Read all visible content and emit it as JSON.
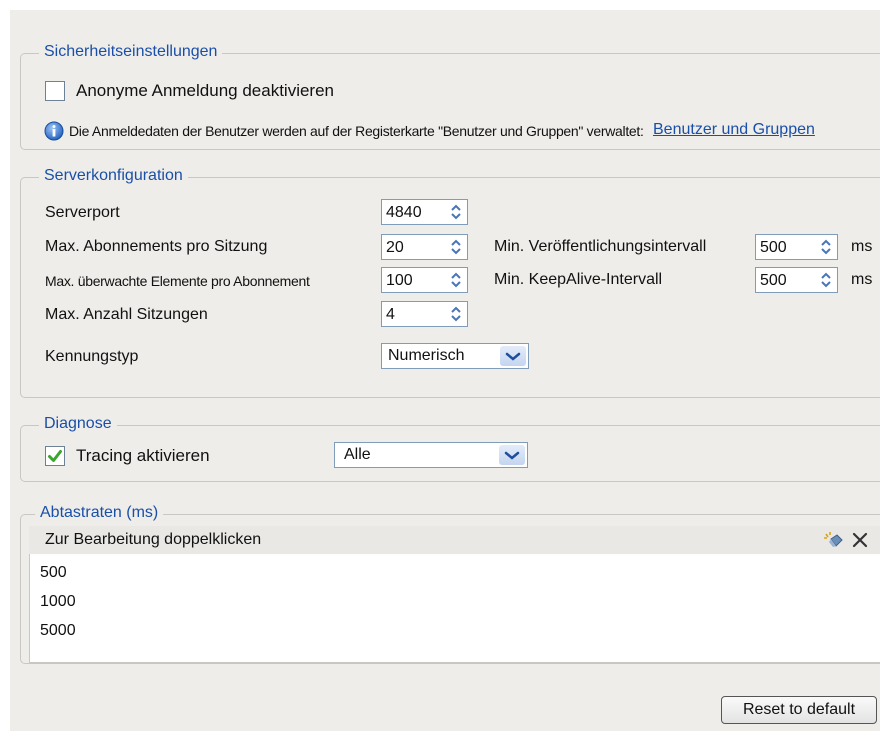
{
  "security": {
    "legend": "Sicherheitseinstellungen",
    "anonymous_checkbox_label": "Anonyme Anmeldung deaktivieren",
    "anonymous_checked": false,
    "info_text": "Die Anmeldedaten der Benutzer werden auf der Registerkarte \"Benutzer und Gruppen\" verwaltet:",
    "info_link": "Benutzer und Gruppen",
    "info_icon": "info-icon"
  },
  "server": {
    "legend": "Serverkonfiguration",
    "port_label": "Serverport",
    "port_value": "4840",
    "max_subscriptions_label": "Max. Abonnements pro Sitzung",
    "max_subscriptions_value": "20",
    "max_monitored_label": "Max. überwachte Elemente pro Abonnement",
    "max_monitored_value": "100",
    "max_sessions_label": "Max. Anzahl Sitzungen",
    "max_sessions_value": "4",
    "id_type_label": "Kennungstyp",
    "id_type_value": "Numerisch",
    "min_publish_label": "Min. Veröffentlichungsintervall",
    "min_publish_value": "500",
    "min_publish_unit": "ms",
    "min_keepalive_label": "Min. KeepAlive-Intervall",
    "min_keepalive_value": "500",
    "min_keepalive_unit": "ms"
  },
  "diagnose": {
    "legend": "Diagnose",
    "tracing_label": "Tracing aktivieren",
    "tracing_checked": true,
    "tracing_level": "Alle"
  },
  "sampling": {
    "legend": "Abtastraten (ms)",
    "header_hint": "Zur Bearbeitung doppelklicken",
    "rows": [
      "500",
      "1000",
      "5000"
    ]
  },
  "reset_button": "Reset to default",
  "colors": {
    "accent": "#1a4fa8",
    "check": "#3aa52f",
    "panel_bg": "#efedea"
  }
}
